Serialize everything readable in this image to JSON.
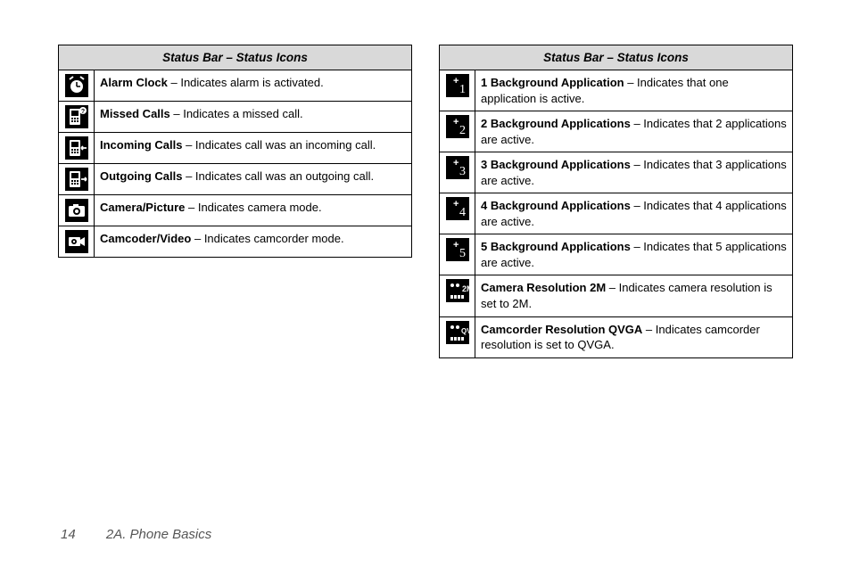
{
  "tables": [
    {
      "header": "Status Bar – Status Icons",
      "rows": [
        {
          "icon": "alarm-clock",
          "term": "Alarm Clock",
          "desc": " – Indicates alarm is activated."
        },
        {
          "icon": "missed-calls",
          "term": "Missed Calls",
          "desc": " – Indicates a missed call."
        },
        {
          "icon": "incoming-calls",
          "term": "Incoming Calls",
          "desc": " – Indicates call was an incoming call."
        },
        {
          "icon": "outgoing-calls",
          "term": "Outgoing Calls",
          "desc": " – Indicates call was an outgoing call."
        },
        {
          "icon": "camera",
          "term": "Camera/Picture",
          "desc": " – Indicates camera mode."
        },
        {
          "icon": "camcorder",
          "term": "Camcoder/Video",
          "desc": " – Indicates camcorder mode."
        }
      ]
    },
    {
      "header": "Status Bar – Status Icons",
      "rows": [
        {
          "icon": "bg1",
          "term": "1 Background Application",
          "desc": " – Indicates that one application is active."
        },
        {
          "icon": "bg2",
          "term": "2 Background Applications",
          "desc": " – Indicates that 2 applications are active."
        },
        {
          "icon": "bg3",
          "term": "3 Background Applications",
          "desc": " – Indicates that 3 applications are active."
        },
        {
          "icon": "bg4",
          "term": "4 Background Applications",
          "desc": " – Indicates that 4 applications are active."
        },
        {
          "icon": "bg5",
          "term": "5 Background Applications",
          "desc": " – Indicates that 5 applications are active."
        },
        {
          "icon": "res2m",
          "term": "Camera Resolution 2M",
          "desc": " – Indicates camera resolution is set to 2M."
        },
        {
          "icon": "resqvga",
          "term": "Camcorder Resolution QVGA",
          "desc": " – Indicates camcorder resolution is set to QVGA."
        }
      ]
    }
  ],
  "footer": {
    "page": "14",
    "section": "2A. Phone Basics"
  }
}
